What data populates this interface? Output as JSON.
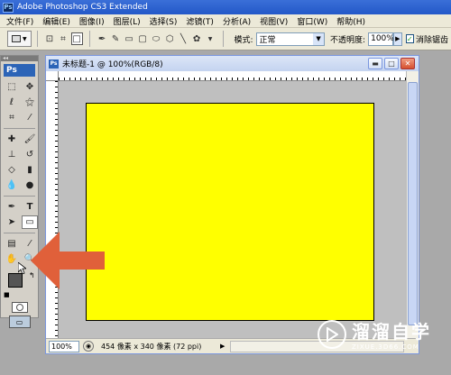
{
  "app": {
    "title": "Adobe Photoshop CS3 Extended",
    "logo": "Ps"
  },
  "menu": [
    "文件(F)",
    "编辑(E)",
    "图像(I)",
    "图层(L)",
    "选择(S)",
    "滤镜(T)",
    "分析(A)",
    "视图(V)",
    "窗口(W)",
    "帮助(H)"
  ],
  "options": {
    "mode_label": "模式:",
    "mode_value": "正常",
    "opacity_label": "不透明度:",
    "opacity_value": "100%",
    "antialias_label": "消除锯齿",
    "antialias_checked": true
  },
  "toolbox": {
    "logo": "Ps",
    "foreground_color": "#555555",
    "background_color": "#ffffff"
  },
  "document": {
    "title": "未标题-1 @ 100%(RGB/8)",
    "canvas_color": "#ffff00",
    "zoom": "100%",
    "info": "454 像素 x 340 像素 (72 ppi)"
  },
  "annotation": {
    "arrow_color": "#e0603a"
  },
  "watermark": {
    "name": "溜溜自学",
    "url": "ZIXUE.3D66.COM"
  }
}
